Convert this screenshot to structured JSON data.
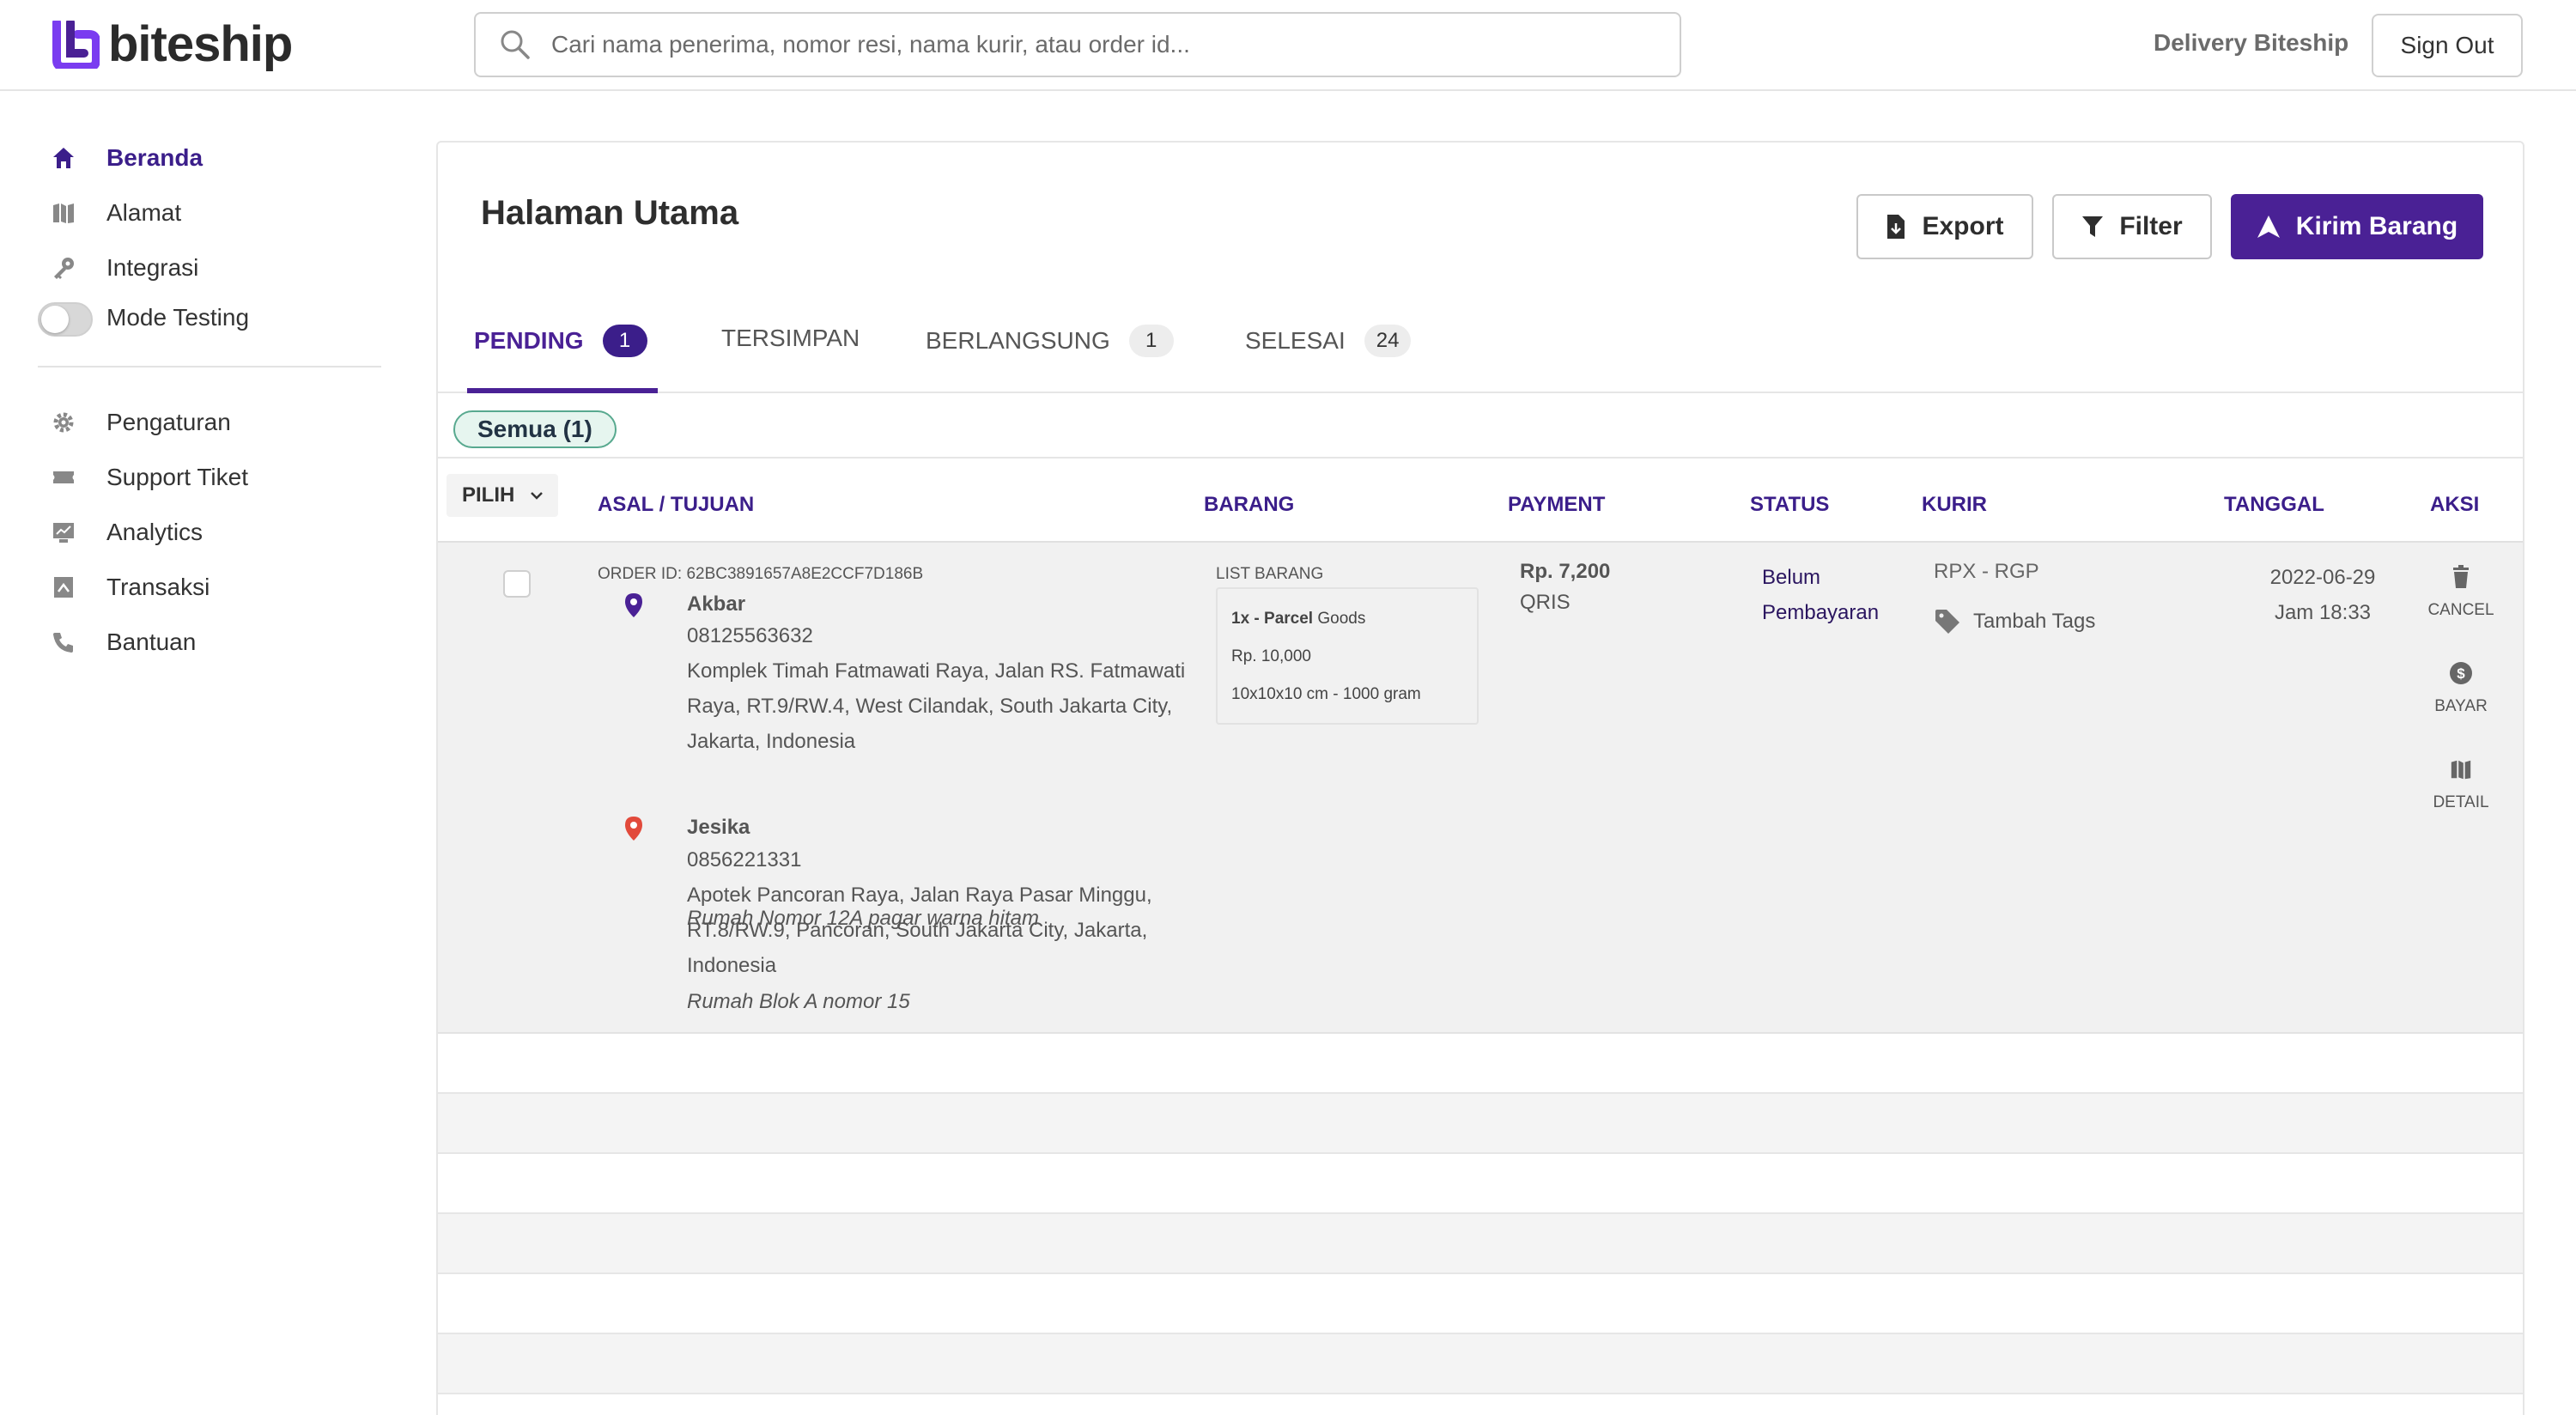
{
  "brand": {
    "name": "biteship",
    "accent": "#4a2195",
    "logo_accent": "#7a3cf0"
  },
  "search": {
    "placeholder": "Cari nama penerima, nomor resi, nama kurir, atau order id..."
  },
  "header": {
    "delivery_link": "Delivery Biteship",
    "signout": "Sign Out"
  },
  "sidebar": {
    "items": [
      {
        "label": "Beranda",
        "icon": "home-icon",
        "active": true
      },
      {
        "label": "Alamat",
        "icon": "map-icon"
      },
      {
        "label": "Integrasi",
        "icon": "key-icon"
      }
    ],
    "mode_testing": "Mode Testing",
    "items2": [
      {
        "label": "Pengaturan",
        "icon": "gear-icon"
      },
      {
        "label": "Support Tiket",
        "icon": "ticket-icon"
      },
      {
        "label": "Analytics",
        "icon": "chart-icon"
      },
      {
        "label": "Transaksi",
        "icon": "receipt-icon"
      },
      {
        "label": "Bantuan",
        "icon": "phone-icon"
      }
    ]
  },
  "main": {
    "title": "Halaman Utama",
    "buttons": {
      "export": "Export",
      "filter": "Filter",
      "kirim": "Kirim Barang"
    },
    "tabs": [
      {
        "label": "PENDING",
        "count": "1",
        "active": true
      },
      {
        "label": "TERSIMPAN",
        "count": ""
      },
      {
        "label": "BERLANGSUNG",
        "count": "1"
      },
      {
        "label": "SELESAI",
        "count": "24"
      }
    ],
    "chip": "Semua (1)",
    "columns": {
      "pilih": "PILIH",
      "asal": "ASAL / TUJUAN",
      "barang": "BARANG",
      "payment": "PAYMENT",
      "status": "STATUS",
      "kurir": "KURIR",
      "tanggal": "TANGGAL",
      "aksi": "AKSI"
    },
    "order": {
      "order_id": "ORDER ID: 62BC3891657A8E2CCF7D186B",
      "origin": {
        "name": "Akbar",
        "phone": "08125563632",
        "address": "Komplek Timah Fatmawati Raya, Jalan RS. Fatmawati Raya, RT.9/RW.4, West Cilandak, South Jakarta City, Jakarta, Indonesia",
        "note": "Rumah Nomor 12A pagar warna hitam"
      },
      "destination": {
        "name": "Jesika",
        "phone": "0856221331",
        "address": "Apotek Pancoran Raya, Jalan Raya Pasar Minggu, RT.8/RW.9, Pancoran, South Jakarta City, Jakarta, Indonesia",
        "note": "Rumah Blok A nomor 15"
      },
      "barang": {
        "label": "LIST BARANG",
        "qty_name": "1x - Parcel",
        "category": "Goods",
        "price": "Rp. 10,000",
        "dims": "10x10x10 cm - 1000 gram"
      },
      "payment": {
        "amount": "Rp. 7,200",
        "method": "QRIS"
      },
      "status": "Belum Pembayaran",
      "kurir": "RPX - RGP",
      "tags": "Tambah Tags",
      "tanggal": {
        "date": "2022-06-29",
        "time": "Jam 18:33"
      },
      "actions": {
        "cancel": "CANCEL",
        "bayar": "BAYAR",
        "detail": "DETAIL"
      }
    }
  }
}
